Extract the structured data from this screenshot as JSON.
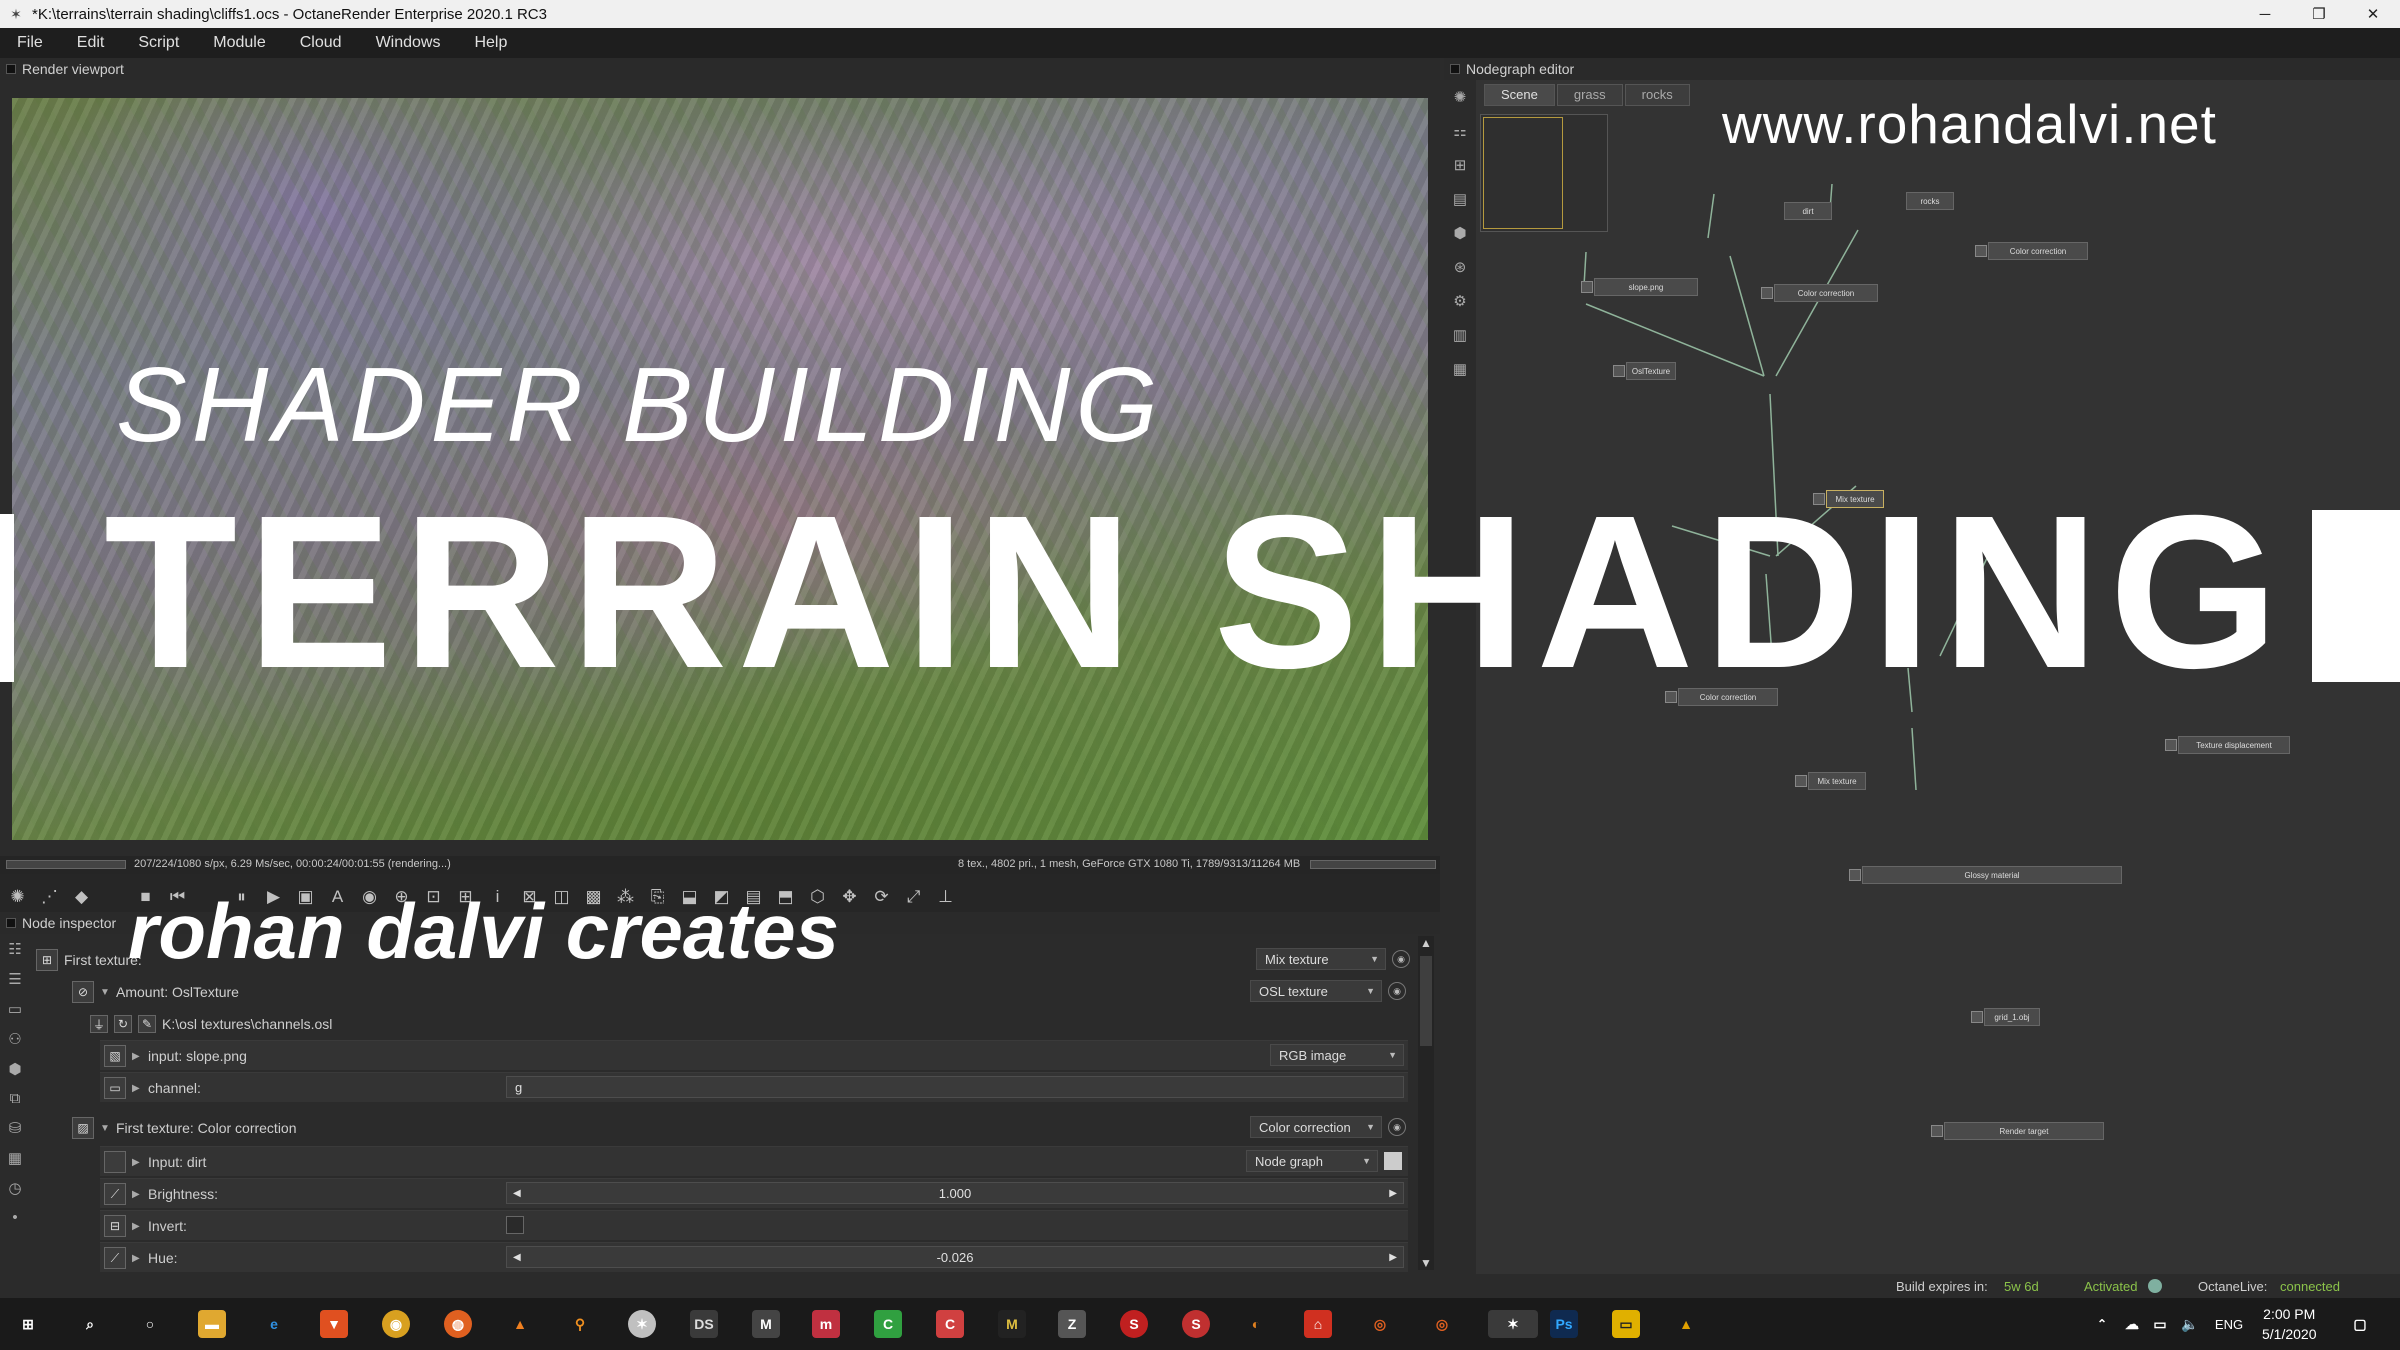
{
  "window": {
    "title": "*K:\\terrains\\terrain shading\\cliffs1.ocs - OctaneRender Enterprise 2020.1 RC3",
    "controls": [
      "─",
      "❐",
      "✕"
    ]
  },
  "menu": [
    "File",
    "Edit",
    "Script",
    "Module",
    "Cloud",
    "Windows",
    "Help"
  ],
  "viewport": {
    "header": "Render viewport",
    "status_left": "207/224/1080 s/px, 6.29 Ms/sec, 00:00:24/00:01:55 (rendering...)",
    "status_right": "8 tex., 4802 pri., 1 mesh, GeForce GTX 1080 Ti, 1789/9313/11264 MB"
  },
  "inspector": {
    "header": "Node inspector",
    "first_texture_label": "First texture:",
    "first_texture_type": "Mix texture",
    "amount_label": "Amount: OslTexture",
    "amount_type": "OSL texture",
    "osl_path": "K:\\osl textures\\channels.osl",
    "input_label": "input: slope.png",
    "input_type": "RGB image",
    "channel_label": "channel:",
    "channel_value": "g",
    "cc_label": "First texture: Color correction",
    "cc_type": "Color correction",
    "cc_input_label": "Input: dirt",
    "cc_input_type": "Node graph",
    "brightness_label": "Brightness:",
    "brightness_value": "1.000",
    "invert_label": "Invert:",
    "hue_label": "Hue:",
    "hue_value": "-0.026"
  },
  "nodegraph": {
    "header": "Nodegraph editor",
    "tabs": [
      "Scene",
      "grass",
      "rocks"
    ],
    "nodes": {
      "dirt": "dirt",
      "rocks": "rocks",
      "slope": "slope.png",
      "cc1": "Color correction",
      "cc2": "Color correction",
      "osl": "OslTexture",
      "mix1": "Mix texture",
      "mix2": "Mix texture",
      "cc3": "Color correction",
      "disp": "Texture displacement",
      "glossy": "Glossy material",
      "geo": "grid_1.obj",
      "render": "Render target"
    }
  },
  "statusbar": {
    "build_label": "Build expires in:",
    "build_value": "5w 6d",
    "activated": "Activated",
    "live_label": "OctaneLive:",
    "live_value": "connected"
  },
  "taskbar": {
    "lang": "ENG",
    "time": "2:00 PM",
    "date": "5/1/2020"
  },
  "overlay": {
    "website": "www.rohandalvi.net",
    "subtitle": "SHADER BUILDING",
    "title": "TERRAIN SHADING",
    "creator": "rohan dalvi creates"
  },
  "colors": {
    "accent": "#c8b060",
    "connected": "#8bc34a"
  }
}
